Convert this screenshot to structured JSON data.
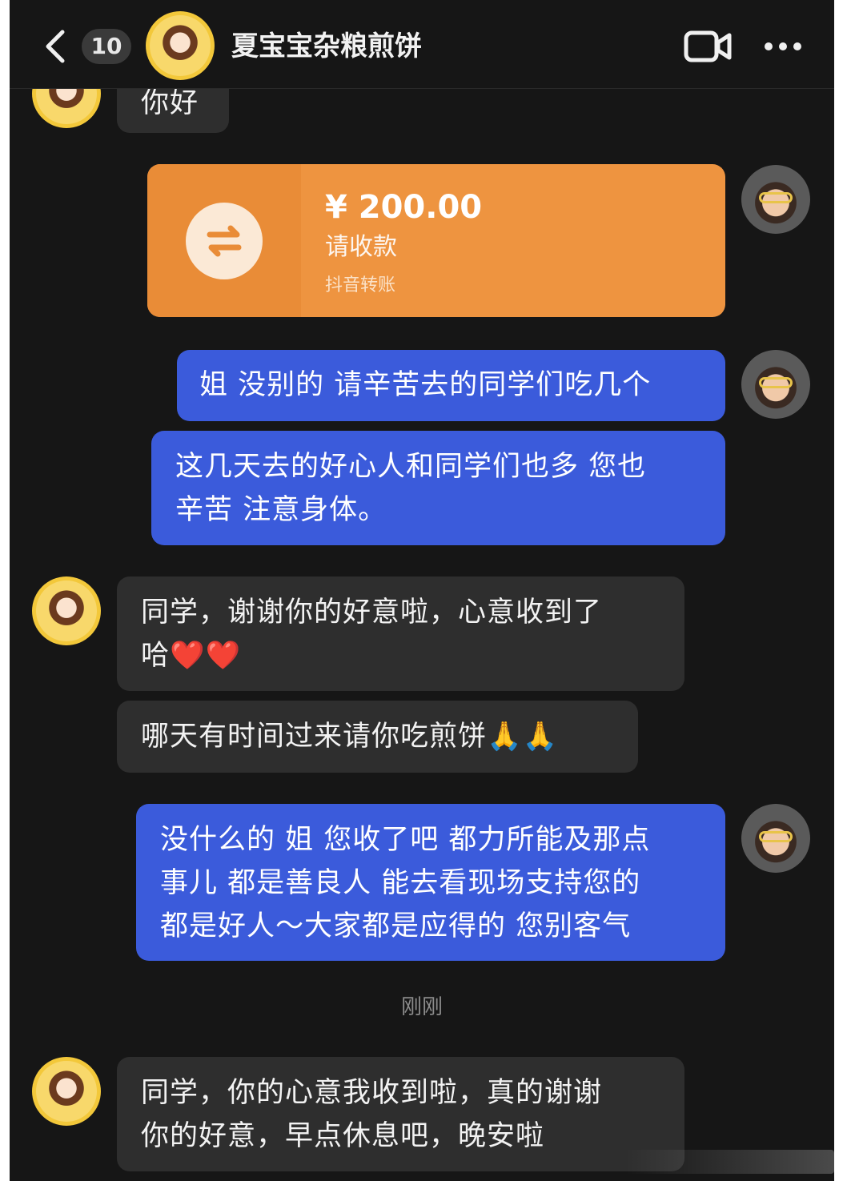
{
  "header": {
    "unread_count": "10",
    "contact_name": "夏宝宝杂粮煎饼"
  },
  "messages": {
    "m0": "你好",
    "transfer": {
      "amount": "¥ 200.00",
      "label": "请收款",
      "source": "抖音转账"
    },
    "m1": "姐 没别的 请辛苦去的同学们吃几个",
    "m2_line1": "这几天去的好心人和同学们也多 您也",
    "m2_line2": "辛苦 注意身体。",
    "m3_line1": "同学，谢谢你的好意啦，心意收到了",
    "m3_line2": "哈❤️❤️",
    "m4": "哪天有时间过来请你吃煎饼🙏🙏",
    "m5_line1": "没什么的 姐 您收了吧 都力所能及那点",
    "m5_line2": "事儿 都是善良人 能去看现场支持您的",
    "m5_line3": "都是好人～大家都是应得的 您别客气",
    "timestamp": "刚刚",
    "m6_line1": "同学，你的心意我收到啦，真的谢谢",
    "m6_line2": "你的好意，早点休息吧，晚安啦"
  },
  "icons": {
    "back": "chevron-left-icon",
    "video": "video-camera-icon",
    "more": "more-dots-icon",
    "transfer": "transfer-arrows-icon"
  },
  "colors": {
    "background": "#161616",
    "incoming_bubble": "#2e2e2e",
    "outgoing_bubble": "#3b5bdb",
    "transfer_card": "#ee9440"
  }
}
